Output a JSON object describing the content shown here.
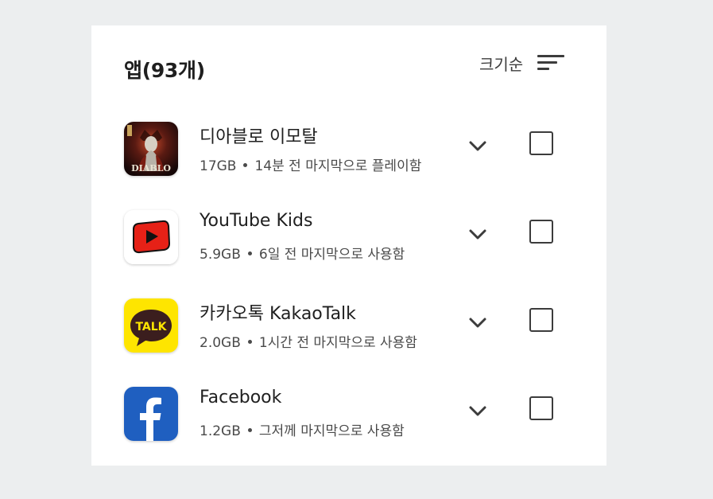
{
  "header": {
    "title": "앱(93개)",
    "sort_label": "크기순"
  },
  "apps": [
    {
      "name": "디아블로 이모탈",
      "size": "17GB",
      "last_used": "14분 전 마지막으로 플레이함",
      "icon": "diablo-immortal-icon",
      "icon_text": "DIABLO",
      "checked": false
    },
    {
      "name": "YouTube Kids",
      "size": "5.9GB",
      "last_used": "6일 전 마지막으로 사용함",
      "icon": "youtube-kids-icon",
      "checked": false
    },
    {
      "name": "카카오톡 KakaoTalk",
      "size": "2.0GB",
      "last_used": "1시간 전 마지막으로 사용함",
      "icon": "kakaotalk-icon",
      "icon_text": "TALK",
      "checked": false
    },
    {
      "name": "Facebook",
      "size": "1.2GB",
      "last_used": "그저께 마지막으로 사용함",
      "icon": "facebook-icon",
      "checked": false
    }
  ],
  "colors": {
    "background": "#eceeef",
    "panel": "#ffffff",
    "text_primary": "#1f1f1f",
    "text_secondary": "#4a4a4a",
    "kakao_yellow": "#fee500",
    "facebook_blue": "#1877f2",
    "youtube_red": "#e62117"
  }
}
